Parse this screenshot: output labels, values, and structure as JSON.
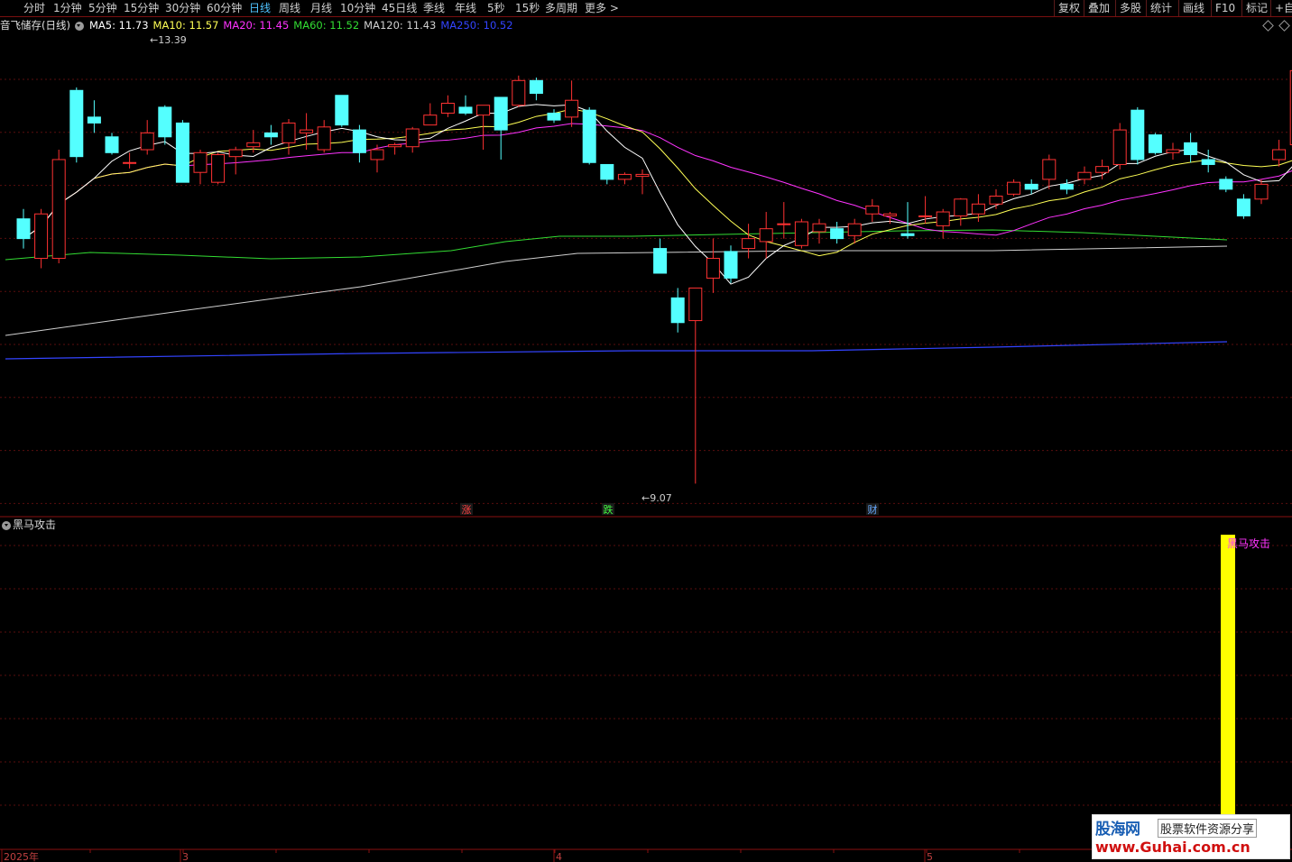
{
  "toolbar": {
    "periods": [
      "分时",
      "1分钟",
      "5分钟",
      "15分钟",
      "30分钟",
      "60分钟",
      "日线",
      "周线",
      "月线",
      "10分钟",
      "45日线",
      "季线",
      "年线",
      "5秒",
      "15秒",
      "多周期",
      "更多 >"
    ],
    "active": "日线",
    "right_buttons": [
      "复权",
      "叠加",
      "多股",
      "统计",
      "画线",
      "F10",
      "标记",
      "+自"
    ]
  },
  "main_chart": {
    "stock_name": "音飞储存(日线)",
    "ma_labels": [
      {
        "text": "MA5: 11.73",
        "color": "#ffffff"
      },
      {
        "text": "MA10: 11.57",
        "color": "#ffff55"
      },
      {
        "text": "MA20: 11.45",
        "color": "#ff33ff"
      },
      {
        "text": "MA60: 11.52",
        "color": "#33dd33"
      },
      {
        "text": "MA120: 11.43",
        "color": "#d0d0d0"
      },
      {
        "text": "MA250: 10.52",
        "color": "#3344ff"
      }
    ],
    "high_label": "13.39",
    "low_label": "9.07",
    "event_markers": [
      {
        "text": "涨",
        "color": "#ff4040",
        "x": 517
      },
      {
        "text": "跌",
        "color": "#40ff40",
        "x": 674
      },
      {
        "text": "财",
        "color": "#66aaff",
        "x": 967
      }
    ]
  },
  "sub_chart": {
    "title": "黑马攻击",
    "signal_label": "黑马攻击",
    "signal_color": "#ffff00",
    "label_color": "#ff33ff"
  },
  "time_axis": [
    "2025年",
    "3",
    "4",
    "5"
  ],
  "watermark": {
    "logo": "股海网",
    "slogan": "股票软件资源分享",
    "url": "www.Guhai.com.cn"
  },
  "chart_data": {
    "type": "candlestick",
    "colors": {
      "up": "#ff3232",
      "down": "#54ffff",
      "ma5": "#ffffff",
      "ma10": "#ffff55",
      "ma20": "#ff33ff",
      "ma60": "#33dd33",
      "ma120": "#d0d0d0",
      "ma250": "#3344ff"
    },
    "y_range": [
      8.9,
      13.6
    ],
    "candles": [
      [
        11.75,
        11.55,
        11.45,
        11.85
      ],
      [
        11.35,
        11.8,
        11.25,
        11.85
      ],
      [
        11.35,
        12.35,
        11.3,
        12.45
      ],
      [
        13.05,
        12.38,
        12.32,
        13.08
      ],
      [
        12.78,
        12.72,
        12.62,
        12.95
      ],
      [
        12.58,
        12.42,
        12.4,
        12.62
      ],
      [
        12.32,
        12.32,
        12.26,
        12.42
      ],
      [
        12.45,
        12.62,
        12.4,
        12.75
      ],
      [
        12.88,
        12.58,
        12.5,
        12.9
      ],
      [
        12.72,
        12.12,
        12.12,
        12.75
      ],
      [
        12.22,
        12.42,
        12.1,
        12.45
      ],
      [
        12.12,
        12.4,
        12.1,
        12.42
      ],
      [
        12.38,
        12.45,
        12.2,
        12.48
      ],
      [
        12.48,
        12.52,
        12.42,
        12.65
      ],
      [
        12.62,
        12.58,
        12.5,
        12.7
      ],
      [
        12.52,
        12.72,
        12.4,
        12.76
      ],
      [
        12.62,
        12.65,
        12.45,
        12.82
      ],
      [
        12.45,
        12.68,
        12.42,
        12.75
      ],
      [
        13.0,
        12.7,
        12.68,
        13.0
      ],
      [
        12.65,
        12.42,
        12.32,
        12.7
      ],
      [
        12.35,
        12.45,
        12.22,
        12.5
      ],
      [
        12.48,
        12.5,
        12.4,
        12.52
      ],
      [
        12.48,
        12.66,
        12.42,
        12.68
      ],
      [
        12.7,
        12.8,
        12.7,
        12.92
      ],
      [
        12.82,
        12.92,
        12.78,
        13.0
      ],
      [
        12.88,
        12.82,
        12.8,
        13.0
      ],
      [
        12.8,
        12.9,
        12.45,
        12.9
      ],
      [
        12.98,
        12.65,
        12.35,
        12.98
      ],
      [
        12.9,
        13.15,
        12.88,
        13.2
      ],
      [
        13.15,
        13.02,
        12.95,
        13.18
      ],
      [
        12.82,
        12.75,
        12.72,
        12.86
      ],
      [
        12.78,
        12.95,
        12.68,
        13.15
      ],
      [
        12.85,
        12.32,
        12.3,
        12.88
      ],
      [
        12.3,
        12.15,
        12.1,
        12.3
      ],
      [
        12.15,
        12.2,
        12.1,
        12.22
      ],
      [
        12.18,
        12.2,
        12.0,
        12.25
      ],
      [
        11.45,
        11.2,
        11.2,
        11.55
      ],
      [
        10.95,
        10.7,
        10.6,
        11.05
      ],
      [
        10.72,
        11.05,
        9.07,
        11.05
      ],
      [
        11.15,
        11.35,
        11.0,
        11.55
      ],
      [
        11.42,
        11.15,
        11.1,
        11.48
      ],
      [
        11.45,
        11.55,
        11.35,
        11.7
      ],
      [
        11.52,
        11.65,
        11.35,
        11.82
      ],
      [
        11.7,
        11.7,
        11.55,
        11.92
      ],
      [
        11.48,
        11.72,
        11.45,
        11.75
      ],
      [
        11.62,
        11.7,
        11.5,
        11.75
      ],
      [
        11.65,
        11.55,
        11.5,
        11.72
      ],
      [
        11.58,
        11.7,
        11.5,
        11.75
      ],
      [
        11.8,
        11.88,
        11.72,
        11.95
      ],
      [
        11.78,
        11.8,
        11.7,
        11.82
      ],
      [
        11.6,
        11.58,
        11.55,
        11.92
      ],
      [
        11.78,
        11.78,
        11.7,
        11.98
      ],
      [
        11.68,
        11.82,
        11.55,
        11.85
      ],
      [
        11.78,
        11.95,
        11.68,
        11.96
      ],
      [
        11.8,
        11.9,
        11.72,
        12.0
      ],
      [
        11.9,
        11.98,
        11.85,
        12.05
      ],
      [
        12.0,
        12.12,
        11.98,
        12.15
      ],
      [
        12.1,
        12.05,
        12.0,
        12.15
      ],
      [
        12.15,
        12.35,
        12.05,
        12.4
      ],
      [
        12.1,
        12.05,
        12.0,
        12.15
      ],
      [
        12.15,
        12.22,
        12.1,
        12.28
      ],
      [
        12.22,
        12.28,
        12.15,
        12.35
      ],
      [
        12.3,
        12.65,
        12.25,
        12.72
      ],
      [
        12.85,
        12.35,
        12.3,
        12.88
      ],
      [
        12.6,
        12.42,
        12.4,
        12.62
      ],
      [
        12.42,
        12.45,
        12.35,
        12.52
      ],
      [
        12.52,
        12.4,
        12.32,
        12.62
      ],
      [
        12.35,
        12.3,
        12.22,
        12.45
      ],
      [
        12.15,
        12.05,
        12.02,
        12.18
      ],
      [
        11.95,
        11.78,
        11.75,
        12.0
      ],
      [
        11.95,
        12.1,
        11.9,
        12.15
      ],
      [
        12.35,
        12.45,
        12.28,
        12.55
      ],
      [
        12.5,
        13.25,
        12.45,
        13.25
      ]
    ]
  }
}
